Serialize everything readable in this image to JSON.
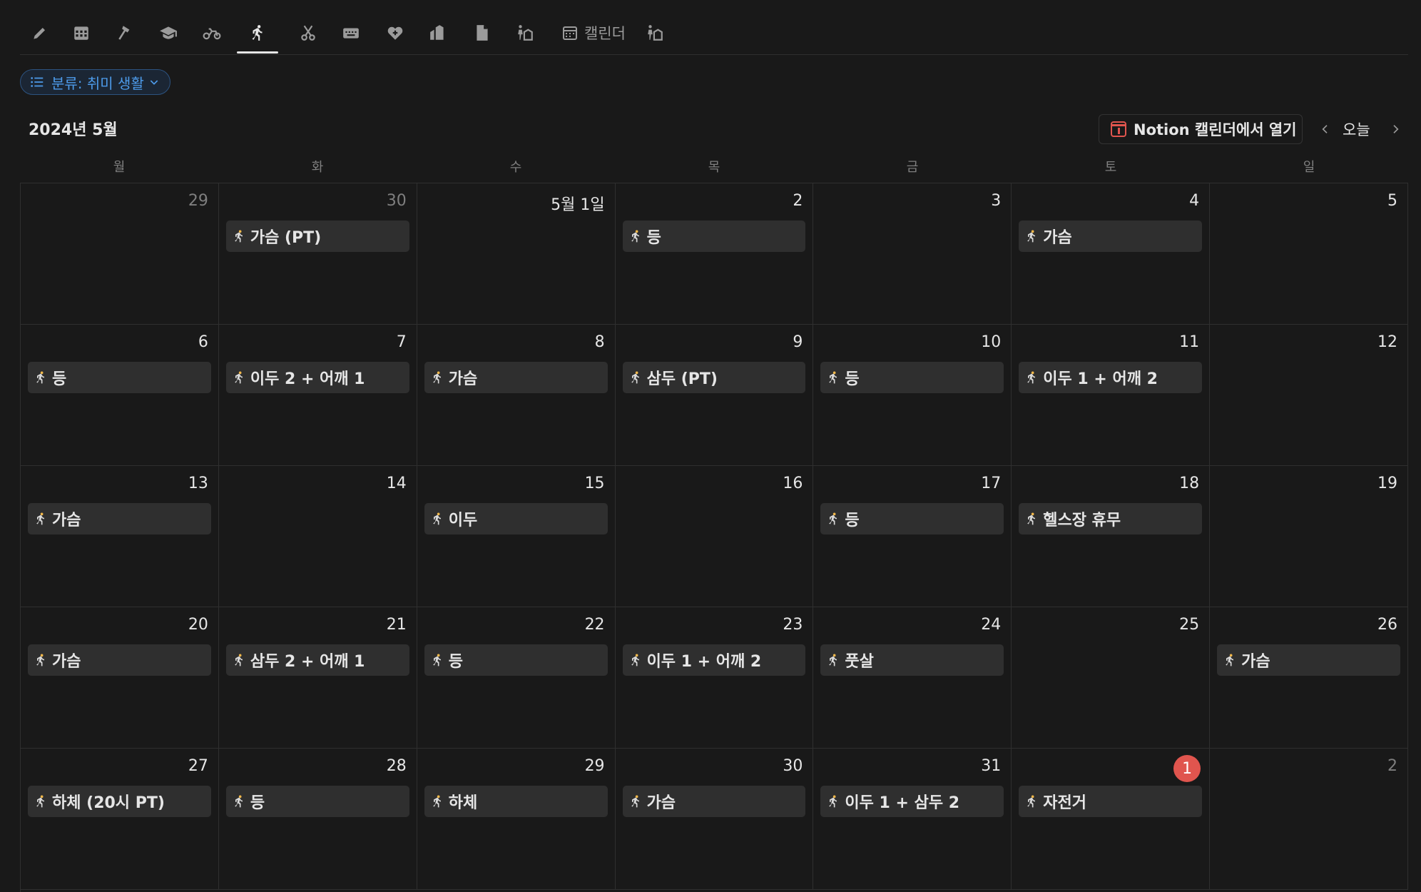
{
  "tabs": [
    {
      "icon": "pencil-icon"
    },
    {
      "icon": "calendar-grid-icon"
    },
    {
      "icon": "hammer-icon"
    },
    {
      "icon": "graduation-cap-icon"
    },
    {
      "icon": "motorcycle-icon"
    },
    {
      "icon": "running-icon",
      "active": true
    },
    {
      "icon": "scissors-icon"
    },
    {
      "icon": "keyboard-icon"
    },
    {
      "icon": "heart-plus-icon"
    },
    {
      "icon": "buildings-icon"
    },
    {
      "icon": "document-icon"
    },
    {
      "icon": "person-building-icon"
    },
    {
      "icon": "calendar-icon",
      "label": "캘린더"
    },
    {
      "icon": "person-building-icon"
    }
  ],
  "filter": {
    "label": "분류: 취미 생활",
    "icon": "list-icon"
  },
  "calendar": {
    "month_title": "2024년 5월",
    "open_notion_label": "Notion 캘린더에서 열기",
    "today_label": "오늘",
    "weekdays": [
      "월",
      "화",
      "수",
      "목",
      "금",
      "토",
      "일"
    ],
    "accent_color": "#e0554e",
    "event_icon": "running-icon",
    "days": [
      {
        "label": "29",
        "faded": true,
        "event": ""
      },
      {
        "label": "30",
        "faded": true,
        "event": "가슴 (PT)"
      },
      {
        "label": "5월 1일",
        "faded": false,
        "event": ""
      },
      {
        "label": "2",
        "faded": false,
        "event": "등"
      },
      {
        "label": "3",
        "faded": false,
        "event": ""
      },
      {
        "label": "4",
        "faded": false,
        "event": "가슴"
      },
      {
        "label": "5",
        "faded": false,
        "event": ""
      },
      {
        "label": "6",
        "faded": false,
        "event": "등"
      },
      {
        "label": "7",
        "faded": false,
        "event": "이두 2 + 어깨 1"
      },
      {
        "label": "8",
        "faded": false,
        "event": "가슴"
      },
      {
        "label": "9",
        "faded": false,
        "event": "삼두 (PT)"
      },
      {
        "label": "10",
        "faded": false,
        "event": "등"
      },
      {
        "label": "11",
        "faded": false,
        "event": "이두 1 + 어깨 2"
      },
      {
        "label": "12",
        "faded": false,
        "event": ""
      },
      {
        "label": "13",
        "faded": false,
        "event": "가슴"
      },
      {
        "label": "14",
        "faded": false,
        "event": ""
      },
      {
        "label": "15",
        "faded": false,
        "event": "이두"
      },
      {
        "label": "16",
        "faded": false,
        "event": ""
      },
      {
        "label": "17",
        "faded": false,
        "event": "등"
      },
      {
        "label": "18",
        "faded": false,
        "event": "헬스장 휴무"
      },
      {
        "label": "19",
        "faded": false,
        "event": ""
      },
      {
        "label": "20",
        "faded": false,
        "event": "가슴"
      },
      {
        "label": "21",
        "faded": false,
        "event": "삼두 2 + 어깨 1"
      },
      {
        "label": "22",
        "faded": false,
        "event": "등"
      },
      {
        "label": "23",
        "faded": false,
        "event": "이두 1 + 어깨 2"
      },
      {
        "label": "24",
        "faded": false,
        "event": "풋살"
      },
      {
        "label": "25",
        "faded": false,
        "event": ""
      },
      {
        "label": "26",
        "faded": false,
        "event": "가슴"
      },
      {
        "label": "27",
        "faded": false,
        "event": "하체 (20시 PT)"
      },
      {
        "label": "28",
        "faded": false,
        "event": "등"
      },
      {
        "label": "29",
        "faded": false,
        "event": "하체"
      },
      {
        "label": "30",
        "faded": false,
        "event": "가슴"
      },
      {
        "label": "31",
        "faded": false,
        "event": "이두 1 + 삼두 2"
      },
      {
        "label": "1",
        "faded": false,
        "today": true,
        "event": "자전거"
      },
      {
        "label": "2",
        "faded": true,
        "event": ""
      }
    ]
  }
}
